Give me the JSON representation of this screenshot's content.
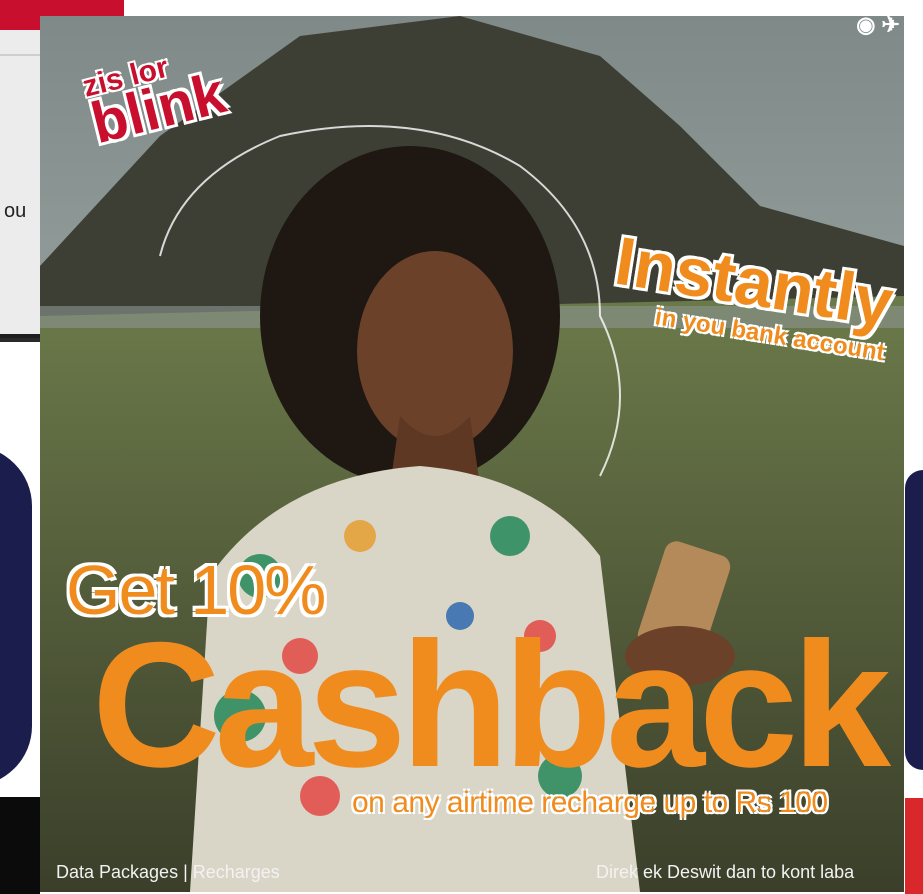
{
  "background": {
    "left_card": {
      "partial_text": "ou",
      "menu_icon": "ellipsis-icon"
    },
    "colors": {
      "navy": "#1b1e4d",
      "red": "#c8102e",
      "orange": "#f08c1e"
    }
  },
  "ad": {
    "logo": {
      "line1": "zis lor",
      "line2": "blink"
    },
    "badge": {
      "headline": "Instantly",
      "subline": "in you bank account"
    },
    "offer": {
      "intro": "Get 10%",
      "headline": "Cashback",
      "detail": "on any airtime recharge up to Rs 100"
    },
    "footer": {
      "left": "Data Packages | Recharges",
      "right": "Direk ek Deswit dan to kont laba"
    }
  }
}
